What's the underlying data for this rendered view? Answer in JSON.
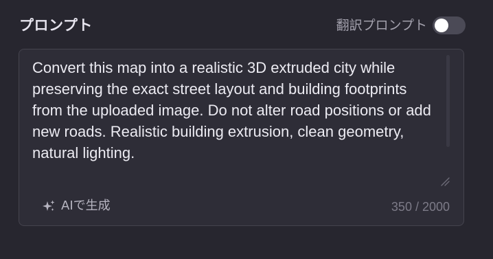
{
  "header": {
    "title": "プロンプト",
    "translate_label": "翻訳プロンプト",
    "translate_toggle_on": false
  },
  "prompt": {
    "text": "Convert this map into a realistic 3D extruded city while preserving the exact street layout and building footprints from the uploaded image. Do not alter road positions or add new roads. Realistic building extrusion, clean geometry, natural lighting."
  },
  "footer": {
    "ai_generate_label": "AIで生成",
    "ai_icon": "sparkles-icon",
    "char_count": "350 / 2000"
  },
  "colors": {
    "background": "#27262f",
    "panel": "#2e2d37",
    "toggle_off": "#4b4a56",
    "text_primary": "#ecebf2",
    "text_muted": "#7d7b88"
  }
}
